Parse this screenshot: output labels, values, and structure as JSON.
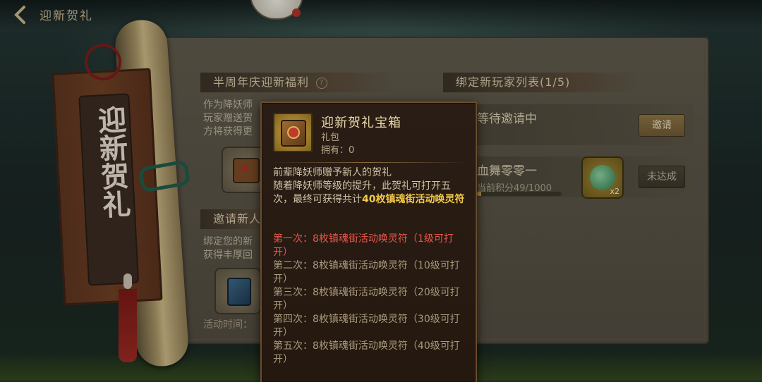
{
  "header": {
    "title": "迎新贺礼"
  },
  "banner": {
    "text": "迎新贺礼"
  },
  "left": {
    "section1_title": "半周年庆迎新福利",
    "section1_help": "?",
    "section1_text_line1": "作为降妖师",
    "section1_text_line2": "玩家赠送贺",
    "section1_text_line3": "方将获得更",
    "section2_title": "邀请新人",
    "section2_text_line1": "绑定您的新",
    "section2_text_line2": "获得丰厚回",
    "activity_time_label": "活动时间："
  },
  "right": {
    "list_title": "绑定新玩家列表(1/5)",
    "rows": [
      {
        "name": "等待邀请中",
        "button": "邀请"
      },
      {
        "name": "血舞零零一",
        "score_label": "当前积分49/1000",
        "score_fraction": 0.049,
        "reward_qty": "x2",
        "button": "未达成"
      }
    ]
  },
  "tooltip": {
    "title": "迎新贺礼宝箱",
    "type": "礼包",
    "owned": "拥有：0",
    "desc_part1": "前辈降妖师赠予新人的贺礼",
    "desc_part2": "随着降妖师等级的提升，此贺礼可打开五次，最终可获得共计",
    "desc_highlight": "40枚镇魂街活动唤灵符",
    "stages": [
      {
        "text": "第一次：8枚镇魂街活动唤灵符（1级可打开）",
        "active": true
      },
      {
        "text": "第二次：8枚镇魂街活动唤灵符（10级可打开）",
        "active": false
      },
      {
        "text": "第三次：8枚镇魂街活动唤灵符（20级可打开）",
        "active": false
      },
      {
        "text": "第四次：8枚镇魂街活动唤灵符（30级可打开）",
        "active": false
      },
      {
        "text": "第五次：8枚镇魂街活动唤灵符（40级可打开）",
        "active": false
      }
    ]
  },
  "colors": {
    "accent_gold": "#f2c94c",
    "active_red": "#e8564a"
  }
}
